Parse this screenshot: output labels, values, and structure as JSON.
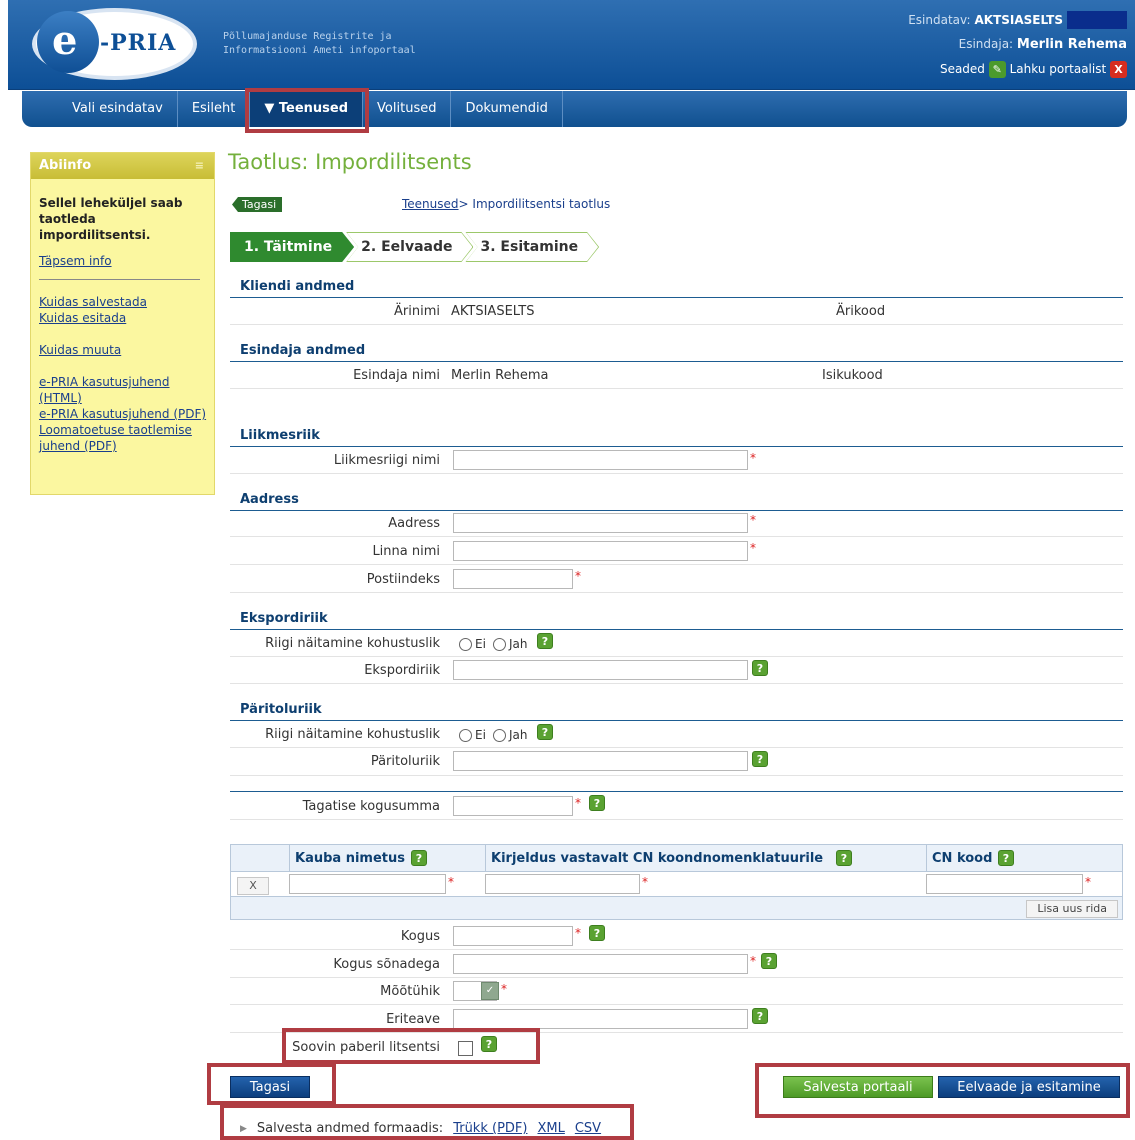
{
  "header": {
    "logo_text": "-PRIA",
    "tagline_line1": "Põllumajanduse Registrite ja",
    "tagline_line2": "Informatsiooni Ameti infoportaal",
    "represented_label": "Esindatav:",
    "represented_value": "AKTSIASELTS",
    "representative_label": "Esindaja:",
    "representative_value": "Merlin Rehema",
    "settings_label": "Seaded",
    "logout_label": "Lahku portaalist"
  },
  "nav": {
    "items": [
      "Vali esindatav",
      "Esileht",
      "Teenused",
      "Volitused",
      "Dokumendid"
    ]
  },
  "sidebar": {
    "title": "Abiinfo",
    "intro": "Sellel leheküljel saab taotleda impordilitsentsi.",
    "more_info": "Täpsem info",
    "links": [
      "Kuidas salvestada",
      "Kuidas esitada",
      "Kuidas muuta",
      "e-PRIA kasutusjuhend (HTML)",
      "e-PRIA kasutusjuhend (PDF)",
      "Loomatoetuse taotlemise juhend (PDF)"
    ]
  },
  "main": {
    "title": "Taotlus: Impordilitsents",
    "back_small": "Tagasi",
    "breadcrumb_link": "Teenused",
    "breadcrumb_rest": "> Impordilitsentsi taotlus",
    "steps": [
      "1. Täitmine",
      "2. Eelvaade",
      "3. Esitamine"
    ]
  },
  "client": {
    "section": "Kliendi andmed",
    "name_label": "Ärinimi",
    "name_value": "AKTSIASELTS",
    "code_label": "Ärikood"
  },
  "representative": {
    "section": "Esindaja andmed",
    "name_label": "Esindaja nimi",
    "name_value": "Merlin Rehema",
    "code_label": "Isikukood"
  },
  "member_state": {
    "section": "Liikmesriik",
    "name_label": "Liikmesriigi nimi"
  },
  "address": {
    "section": "Aadress",
    "address_label": "Aadress",
    "city_label": "Linna nimi",
    "postal_label": "Postiindeks"
  },
  "export_country": {
    "section": "Ekspordiriik",
    "mandatory_label": "Riigi näitamine kohustuslik",
    "no": "Ei",
    "yes": "Jah",
    "country_label": "Ekspordiriik"
  },
  "origin_country": {
    "section": "Päritoluriik",
    "mandatory_label": "Riigi näitamine kohustuslik",
    "no": "Ei",
    "yes": "Jah",
    "country_label": "Päritoluriik"
  },
  "guarantee": {
    "label": "Tagatise kogusumma"
  },
  "goods_table": {
    "col_name": "Kauba nimetus",
    "col_description": "Kirjeldus vastavalt CN koondnomenklatuurile",
    "col_cn": "CN kood",
    "delete_label": "X",
    "add_row": "Lisa uus rida"
  },
  "quantity": {
    "qty_label": "Kogus",
    "qty_words_label": "Kogus sõnadega",
    "unit_label": "Mõõtühik",
    "remarks_label": "Eriteave",
    "paper_label": "Soovin paberil litsentsi"
  },
  "actions": {
    "back": "Tagasi",
    "save": "Salvesta portaali",
    "preview": "Eelvaade ja esitamine"
  },
  "export_formats": {
    "label": "Salvesta andmed formaadis:",
    "formats": [
      "Trükk (PDF)",
      "XML",
      "CSV"
    ]
  },
  "help_glyph": "?",
  "required_glyph": "*",
  "colors": {
    "header_blue": "#0d4f96",
    "title_green": "#74b03c",
    "highlight_red": "#b03c42",
    "sidebar_yellow": "#fbf7a0"
  }
}
